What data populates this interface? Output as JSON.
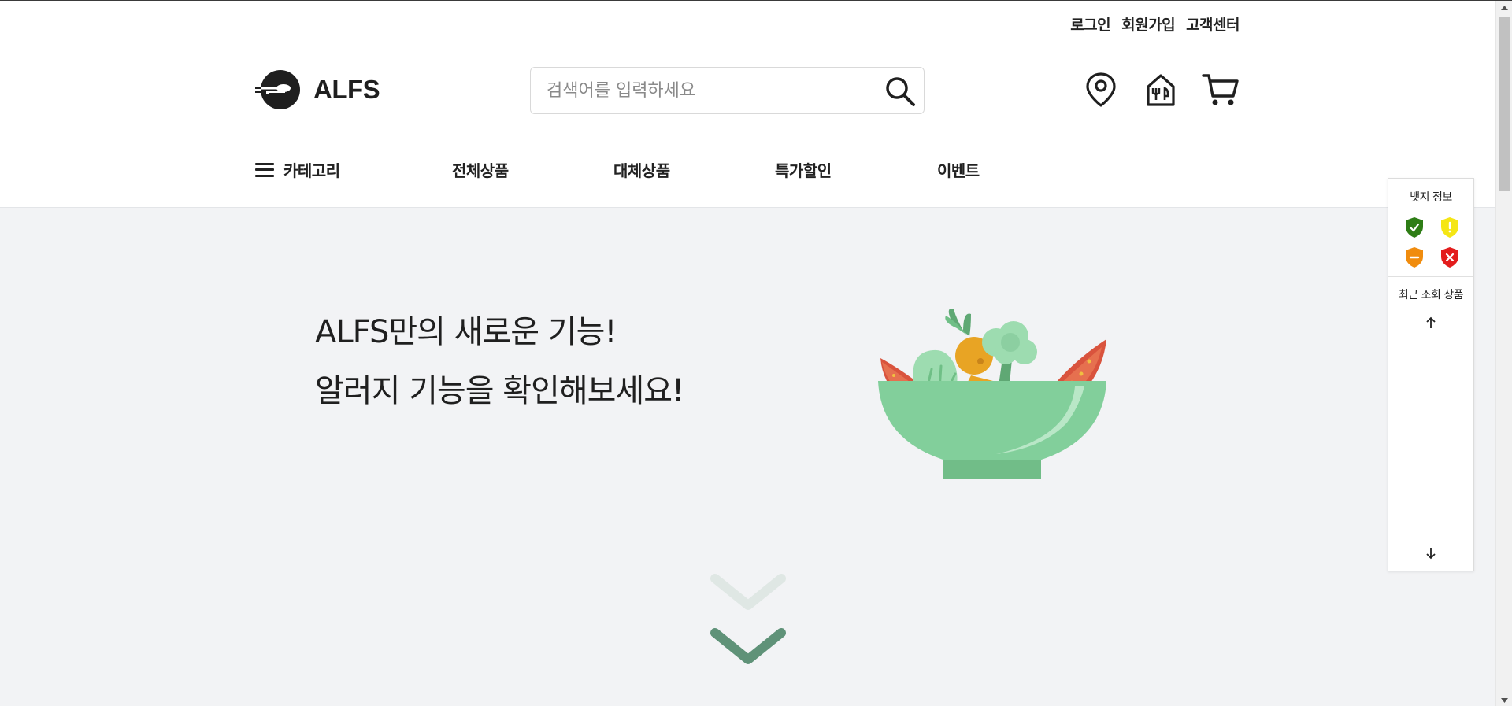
{
  "util_links": [
    "로그인",
    "회원가입",
    "고객센터"
  ],
  "logo": {
    "text": "ALFS"
  },
  "search": {
    "placeholder": "검색어를 입력하세요"
  },
  "header_icons": [
    "location-pin-icon",
    "restaurant-store-icon",
    "cart-icon"
  ],
  "nav": {
    "category": "카테고리",
    "items": [
      "전체상품",
      "대체상품",
      "특가할인",
      "이벤트"
    ]
  },
  "hero": {
    "line1": "ALFS만의 새로운 기능!",
    "line2": "알러지 기능을 확인해보세요!"
  },
  "side_panel": {
    "badge_title": "뱃지 정보",
    "badges": [
      {
        "icon": "shield-check-icon",
        "color": "#2e7d16"
      },
      {
        "icon": "shield-exclamation-icon",
        "color": "#f5e614"
      },
      {
        "icon": "shield-minus-icon",
        "color": "#f08c0e"
      },
      {
        "icon": "shield-x-icon",
        "color": "#e31c1c"
      }
    ],
    "recent_title": "최근 조회 상품"
  },
  "colors": {
    "hero_bg": "#f2f3f5",
    "bowl_green": "#82cf9b",
    "chevron_dark": "#5f9278",
    "chevron_light": "#dfe7e4"
  }
}
